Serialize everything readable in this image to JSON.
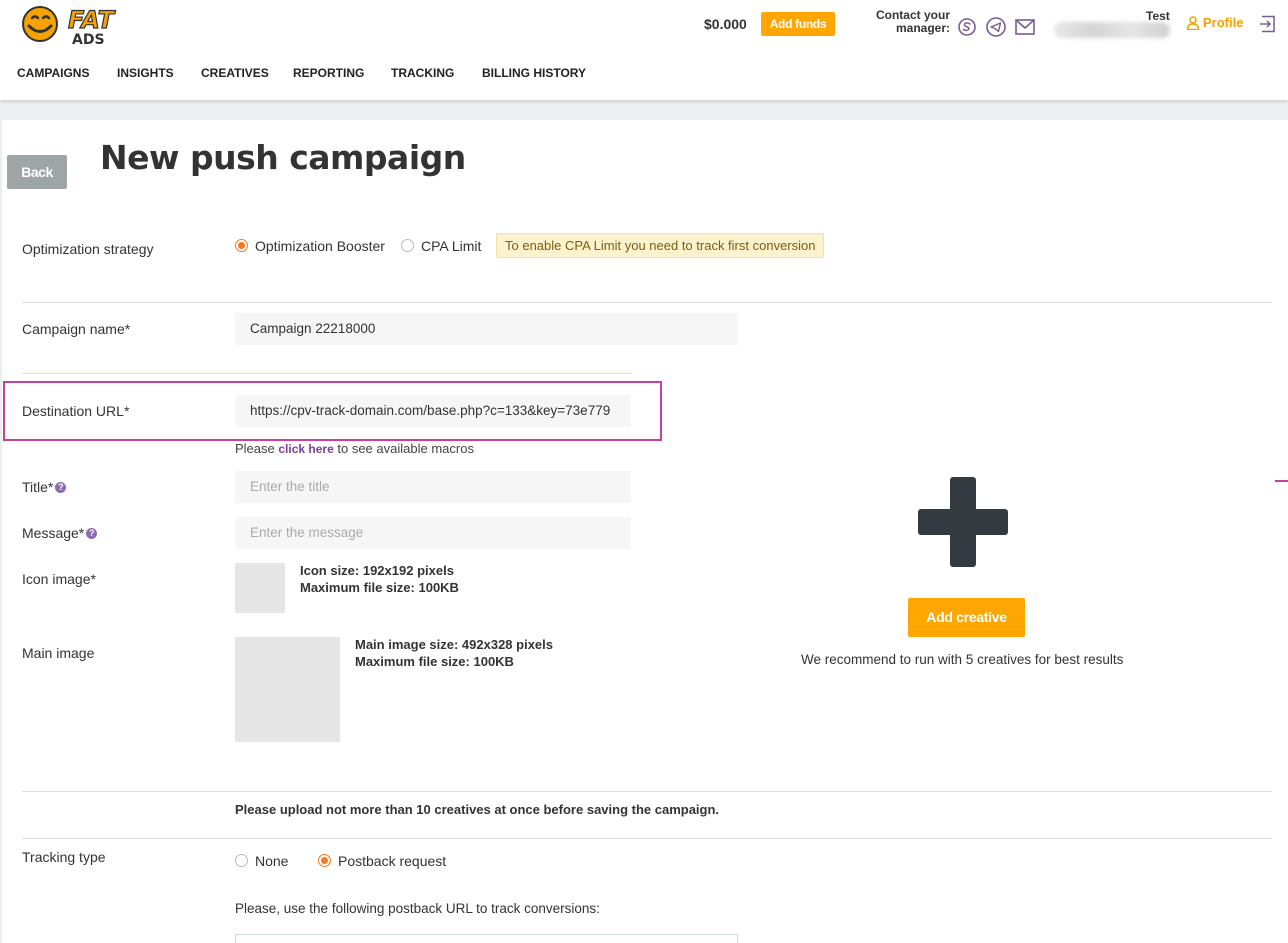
{
  "header": {
    "logo_text_top": "FAT",
    "logo_text_bottom": "ADS",
    "balance": "$0.000",
    "add_funds_label": "Add funds",
    "contact_manager_line1": "Contact your",
    "contact_manager_line2": "manager:",
    "contact_icons": [
      "skype-icon",
      "telegram-icon",
      "mail-icon"
    ],
    "user_name": "Test",
    "profile_label": "Profile"
  },
  "nav": {
    "items": [
      {
        "label": "CAMPAIGNS"
      },
      {
        "label": "INSIGHTS"
      },
      {
        "label": "CREATIVES"
      },
      {
        "label": "REPORTING"
      },
      {
        "label": "TRACKING"
      },
      {
        "label": "BILLING HISTORY"
      }
    ]
  },
  "page": {
    "back_label": "Back",
    "title": "New push campaign"
  },
  "form": {
    "optimization": {
      "label": "Optimization strategy",
      "options": [
        "Optimization Booster",
        "CPA Limit"
      ],
      "selected": "Optimization Booster",
      "notice": "To enable CPA Limit you need to track first conversion"
    },
    "campaign_name": {
      "label": "Campaign name*",
      "value": "Campaign 22218000"
    },
    "destination_url": {
      "label": "Destination URL*",
      "value": "https://cpv-track-domain.com/base.php?c=133&key=73e779",
      "hint_prefix": "Please",
      "hint_link": "click here",
      "hint_suffix": "to see available macros"
    },
    "title": {
      "label": "Title*",
      "placeholder": "Enter the title"
    },
    "message": {
      "label": "Message*",
      "placeholder": "Enter the message"
    },
    "icon_image": {
      "label": "Icon image*",
      "info_line1": "Icon size: 192x192 pixels",
      "info_line2": "Maximum file size: 100KB"
    },
    "main_image": {
      "label": "Main image",
      "info_line1": "Main image size: 492x328 pixels",
      "info_line2": "Maximum file size: 100KB"
    },
    "upload_note": "Please upload not more than 10 creatives at once before saving the campaign.",
    "tracking": {
      "label": "Tracking type",
      "options": [
        "None",
        "Postback request"
      ],
      "selected": "Postback request",
      "postback_note": "Please, use the following postback URL to track conversions:"
    }
  },
  "creative": {
    "add_label": "Add creative",
    "recommend": "We recommend to run with 5 creatives for best results"
  },
  "colors": {
    "accent": "#ffa600",
    "radio": "#f07a24",
    "highlight": "#c9409c",
    "icon_purple": "#7b5a95"
  }
}
